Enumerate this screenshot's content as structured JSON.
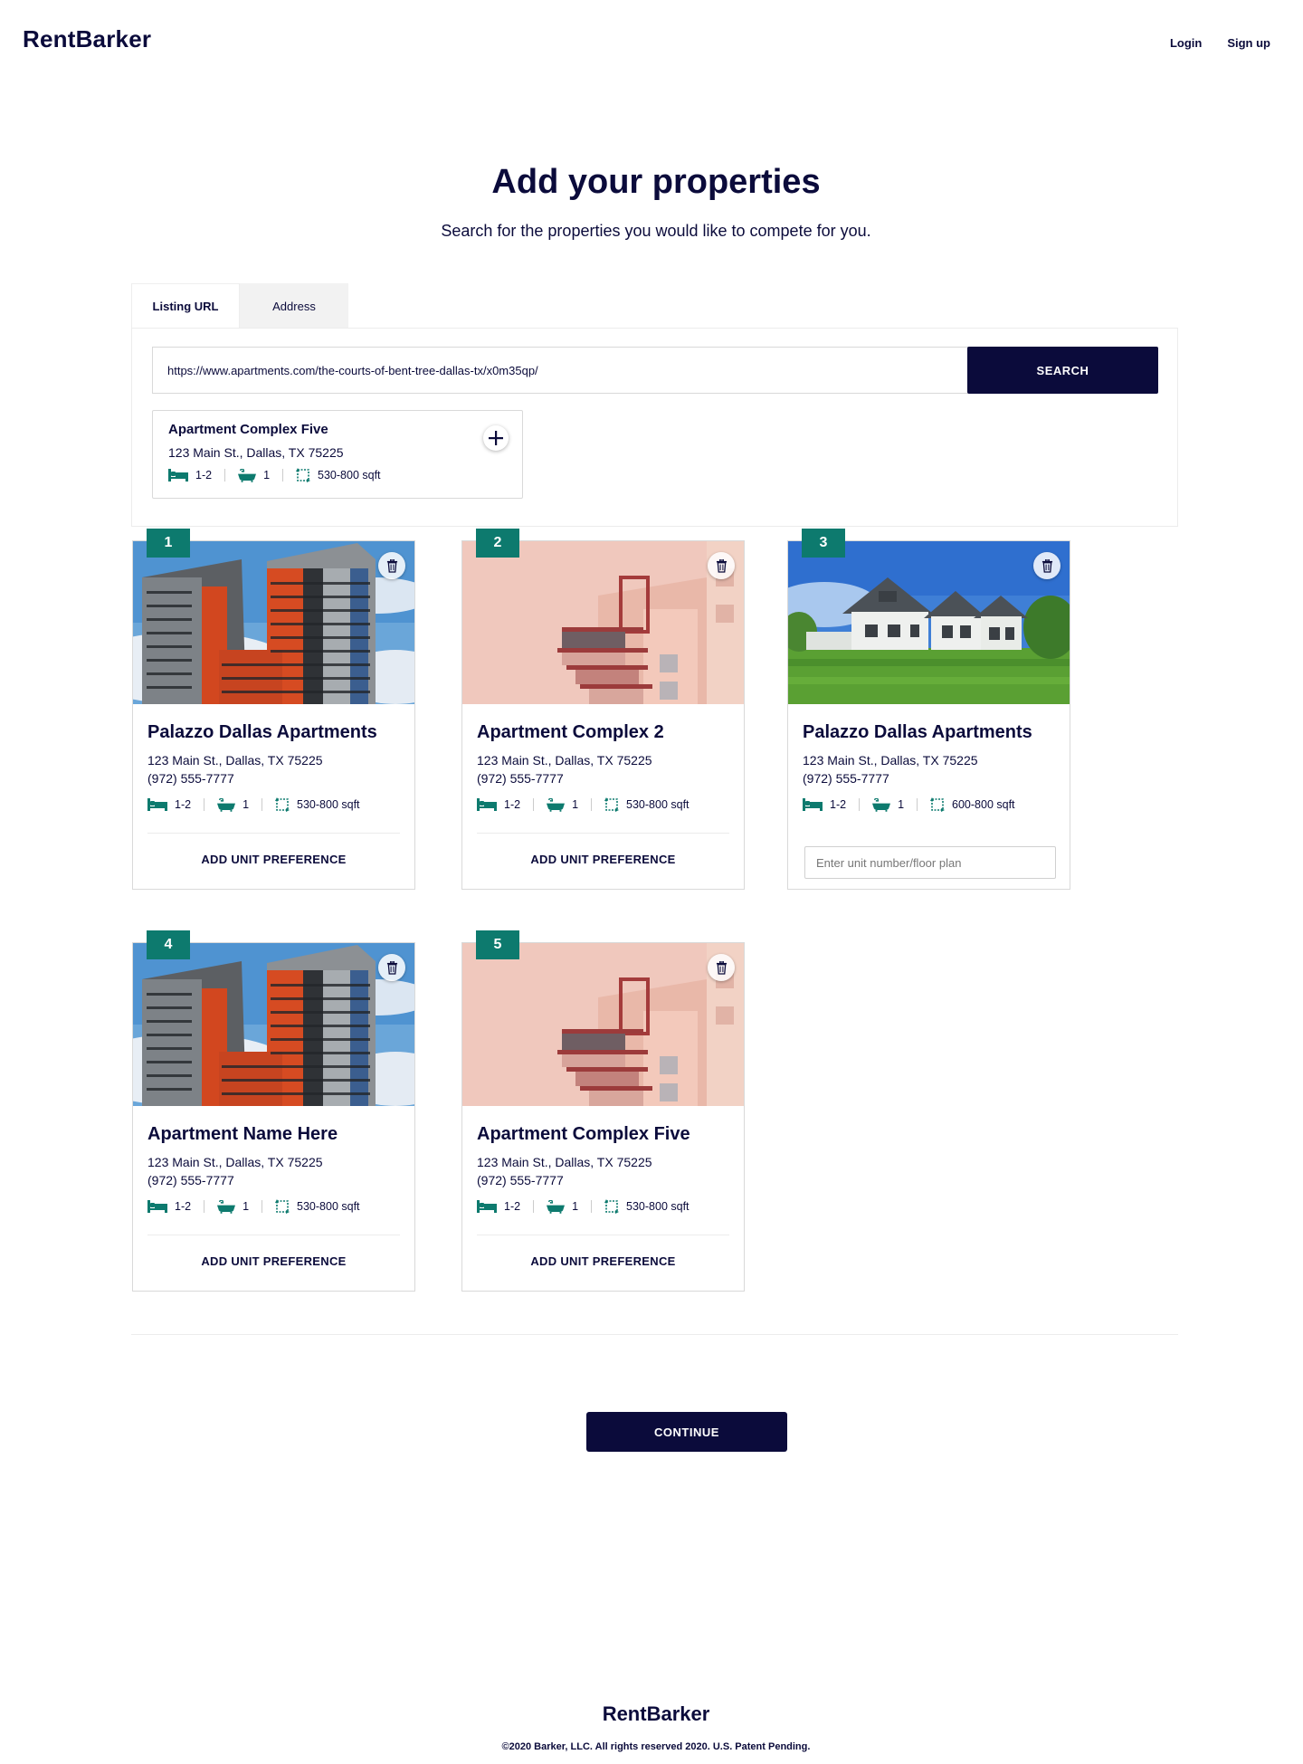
{
  "header": {
    "logo": "RentBarker",
    "login": "Login",
    "signup": "Sign up"
  },
  "page": {
    "title": "Add your properties",
    "subtitle": "Search for the properties you would like to compete for you."
  },
  "tabs": [
    {
      "label": "Listing URL",
      "active": true
    },
    {
      "label": "Address",
      "active": false
    }
  ],
  "search": {
    "url_value": "https://www.apartments.com/the-courts-of-bent-tree-dallas-tx/x0m35qp/",
    "button_label": "SEARCH"
  },
  "result": {
    "name": "Apartment Complex Five",
    "address": "123 Main St., Dallas, TX 75225",
    "beds": "1-2",
    "baths": "1",
    "sqft": "530-800 sqft"
  },
  "properties": [
    {
      "number": "1",
      "name": "Palazzo Dallas Apartments",
      "address": "123 Main St., Dallas, TX 75225",
      "phone": "(972) 555-7777",
      "beds": "1-2",
      "baths": "1",
      "sqft": "530-800 sqft",
      "action": "ADD UNIT PREFERENCE",
      "photo": "highrise"
    },
    {
      "number": "2",
      "name": "Apartment Complex 2",
      "address": "123 Main St., Dallas, TX 75225",
      "phone": "(972) 555-7777",
      "beds": "1-2",
      "baths": "1",
      "sqft": "530-800 sqft",
      "action": "ADD UNIT PREFERENCE",
      "photo": "pink"
    },
    {
      "number": "3",
      "name": "Palazzo Dallas Apartments",
      "address": "123 Main St., Dallas, TX 75225",
      "phone": "(972) 555-7777",
      "beds": "1-2",
      "baths": "1",
      "sqft": "600-800 sqft",
      "unit_placeholder": "Enter unit number/floor plan",
      "photo": "house"
    },
    {
      "number": "4",
      "name": "Apartment Name Here",
      "address": "123 Main St., Dallas, TX 75225",
      "phone": "(972) 555-7777",
      "beds": "1-2",
      "baths": "1",
      "sqft": "530-800 sqft",
      "action": "ADD UNIT PREFERENCE",
      "photo": "highrise"
    },
    {
      "number": "5",
      "name": "Apartment Complex Five",
      "address": "123 Main St., Dallas, TX 75225",
      "phone": "(972) 555-7777",
      "beds": "1-2",
      "baths": "1",
      "sqft": "530-800 sqft",
      "action": "ADD UNIT PREFERENCE",
      "photo": "pink"
    }
  ],
  "continue_label": "CONTINUE",
  "footer": {
    "logo": "RentBarker",
    "copyright": "©2020 Barker, LLC. All rights reserved 2020. U.S. Patent Pending."
  },
  "colors": {
    "navy": "#0b0b3b",
    "teal": "#0d7a6e"
  },
  "icons": [
    "bed-icon",
    "bath-icon",
    "area-icon",
    "plus-icon",
    "trash-icon"
  ]
}
